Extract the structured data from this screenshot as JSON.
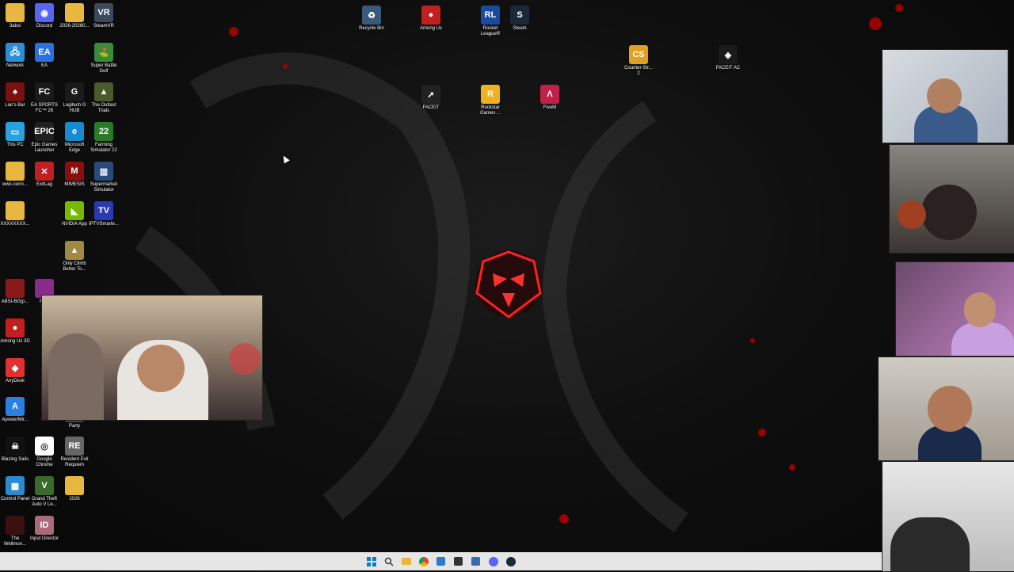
{
  "desktop_icons": [
    {
      "label": "3absi",
      "color": "#e8b740",
      "glyph": ""
    },
    {
      "label": "Discord",
      "color": "#5865f2",
      "glyph": "◉"
    },
    {
      "label": "2026-20260...",
      "color": "#e8b740",
      "glyph": ""
    },
    {
      "label": "SteamVR",
      "color": "#3a4a5c",
      "glyph": "VR"
    },
    {
      "label": "Network",
      "color": "#2a8fd6",
      "glyph": "🖧"
    },
    {
      "label": "EA",
      "color": "#2e6fe0",
      "glyph": "EA"
    },
    {
      "label": "Super Battle Golf",
      "color": "#3a8a3a",
      "glyph": "⛳"
    },
    {
      "label": "Liar's Bar",
      "color": "#7a1010",
      "glyph": "♠"
    },
    {
      "label": "EA SPORTS FC™ 26",
      "color": "#1a1a1a",
      "glyph": "FC"
    },
    {
      "label": "Logitech G HUB",
      "color": "#1a1a1a",
      "glyph": "G"
    },
    {
      "label": "The Outlast Trials",
      "color": "#4a5a2a",
      "glyph": "▲"
    },
    {
      "label": "This PC",
      "color": "#2aa0e0",
      "glyph": "▭"
    },
    {
      "label": "Epic Games Launcher",
      "color": "#202020",
      "glyph": "EPIC"
    },
    {
      "label": "Microsoft Edge",
      "color": "#1a8ad0",
      "glyph": "e"
    },
    {
      "label": "Farming Simulator 22",
      "color": "#2a7a2a",
      "glyph": "22"
    },
    {
      "label": "wwc-conn...",
      "color": "#e8b740",
      "glyph": ""
    },
    {
      "label": "ExitLag",
      "color": "#c02020",
      "glyph": "✕"
    },
    {
      "label": "MIMESIS",
      "color": "#8a1010",
      "glyph": "M"
    },
    {
      "label": "Supermarket Simulator",
      "color": "#2a4a7a",
      "glyph": "▥"
    },
    {
      "label": "XXXXXXXX...",
      "color": "#e8b740",
      "glyph": ""
    },
    {
      "label": "NVIDIA App",
      "color": "#76b900",
      "glyph": "◣"
    },
    {
      "label": "IPTVSmarte...",
      "color": "#2a3ab0",
      "glyph": "TV"
    },
    {
      "label": "Only Climb Better To...",
      "color": "#a08a40",
      "glyph": "▲"
    },
    {
      "label": "ABSI-BG(p...",
      "color": "#8a1a1a",
      "glyph": ""
    },
    {
      "label": "Fe...",
      "color": "#8a2a8a",
      "glyph": ""
    },
    {
      "label": "Among Us 3D",
      "color": "#c02020",
      "glyph": "●"
    },
    {
      "label": "AnyDesk",
      "color": "#e03030",
      "glyph": "◆"
    },
    {
      "label": "ApowerMir...",
      "color": "#2a80e0",
      "glyph": "A"
    },
    {
      "label": "Party",
      "color": "#444",
      "glyph": ""
    },
    {
      "label": "Blazing Sails",
      "color": "#111",
      "glyph": "☠"
    },
    {
      "label": "Google Chrome",
      "color": "#fff",
      "glyph": "◎"
    },
    {
      "label": "Resident Evil Requiem",
      "color": "#666",
      "glyph": "RE"
    },
    {
      "label": "Control Panel",
      "color": "#2a8ad0",
      "glyph": "▦"
    },
    {
      "label": "Grand Theft Auto V Le...",
      "color": "#3a6a2a",
      "glyph": "V"
    },
    {
      "label": "2026",
      "color": "#e8b740",
      "glyph": ""
    },
    {
      "label": "The Wellmon...",
      "color": "#3a1010",
      "glyph": ""
    },
    {
      "label": "Input Director",
      "color": "#aa6a7a",
      "glyph": "ID"
    },
    {
      "label": "Recycle Bin",
      "color": "#3a5a7a",
      "glyph": "♻"
    },
    {
      "label": "Among Us",
      "color": "#c02020",
      "glyph": "●"
    },
    {
      "label": "Rocket League®",
      "color": "#1a4aa0",
      "glyph": "RL"
    },
    {
      "label": "Steam",
      "color": "#1b2838",
      "glyph": "S"
    },
    {
      "label": "FACEIT",
      "color": "#222",
      "glyph": "➚"
    },
    {
      "label": "Rockstar Games ...",
      "color": "#f0b020",
      "glyph": "R"
    },
    {
      "label": "FiveM",
      "color": "#c0204a",
      "glyph": "Λ"
    },
    {
      "label": "Counter-Str... 2",
      "color": "#e0a020",
      "glyph": "CS"
    },
    {
      "label": "FACEIT AC",
      "color": "#1a1a1a",
      "glyph": "◈"
    }
  ],
  "taskbar": [
    "start",
    "search",
    "files",
    "chrome",
    "store",
    "xbox",
    "terminal",
    "discord",
    "steam"
  ]
}
